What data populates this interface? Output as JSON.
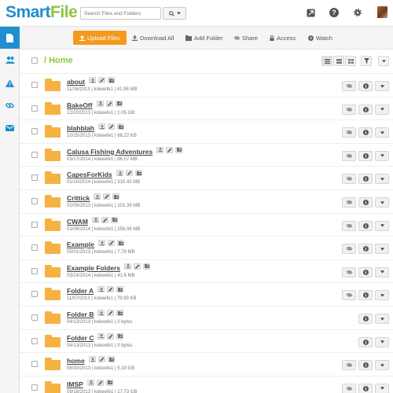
{
  "app": {
    "logo_smart": "Smart",
    "logo_file": "File",
    "search_placeholder": "Search Files and Folders"
  },
  "header_icons": [
    "image-icon",
    "help-icon",
    "gear-icon",
    "user-avatar"
  ],
  "sidebar": {
    "items": [
      {
        "icon": "file-icon",
        "active": true
      },
      {
        "icon": "users-icon",
        "active": false
      },
      {
        "icon": "warning-icon",
        "active": false
      },
      {
        "icon": "link-icon",
        "active": false
      },
      {
        "icon": "envelope-icon",
        "active": false
      }
    ]
  },
  "toolbar": {
    "upload_label": "Upload Files",
    "download_label": "Download All",
    "add_folder_label": "Add Folder",
    "share_label": "Share",
    "access_label": "Access",
    "watch_label": "Watch"
  },
  "breadcrumb": {
    "title": "/ Home"
  },
  "colors": {
    "brand_blue": "#1f8fcf",
    "brand_green": "#8cc63f",
    "upload_orange": "#f39a1d",
    "folder_yellow": "#f5b243"
  },
  "files": [
    {
      "name": "about",
      "date": "11/26/2013",
      "owner": "kokeefe1",
      "size": "41.96 MB",
      "shared": true
    },
    {
      "name": "BakeOff",
      "date": "12/20/2013",
      "owner": "kokeefe1",
      "size": "1.05 GB",
      "shared": true
    },
    {
      "name": "blahblah",
      "date": "10/25/2013",
      "owner": "kokeefe1",
      "size": "68.22 KB",
      "shared": true
    },
    {
      "name": "Calusa Fishing Adventures",
      "date": "03/17/2014",
      "owner": "kokeefe1",
      "size": "86.57 MB",
      "shared": true
    },
    {
      "name": "CapesForKids",
      "date": "01/10/2014",
      "owner": "kokeefe1",
      "size": "315.43 MB",
      "shared": true
    },
    {
      "name": "Crittick",
      "date": "02/05/2013",
      "owner": "kokeefe1",
      "size": "103.39 MB",
      "shared": true
    },
    {
      "name": "CWAM",
      "date": "01/09/2014",
      "owner": "kokeefe1",
      "size": "256.08 MB",
      "shared": true
    },
    {
      "name": "Example",
      "date": "05/01/2013",
      "owner": "kokeefe1",
      "size": "7.79 MB",
      "shared": true
    },
    {
      "name": "Example Folders",
      "date": "03/24/2014",
      "owner": "kokeefe1",
      "size": "41.6 MB",
      "shared": true
    },
    {
      "name": "Folder A",
      "date": "11/07/2013",
      "owner": "kokeefe1",
      "size": "79.99 KB",
      "shared": true
    },
    {
      "name": "Folder B",
      "date": "04/13/2013",
      "owner": "kokeefe1",
      "size": "0 bytes",
      "shared": false
    },
    {
      "name": "Folder C",
      "date": "04/13/2013",
      "owner": "kokeefe1",
      "size": "0 bytes",
      "shared": false
    },
    {
      "name": "home",
      "date": "08/30/2013",
      "owner": "kokeefe1",
      "size": "5.19 GB",
      "shared": true
    },
    {
      "name": "IMSP",
      "date": "09/18/2013",
      "owner": "kokeefe1",
      "size": "17.73 GB",
      "shared": true
    }
  ]
}
